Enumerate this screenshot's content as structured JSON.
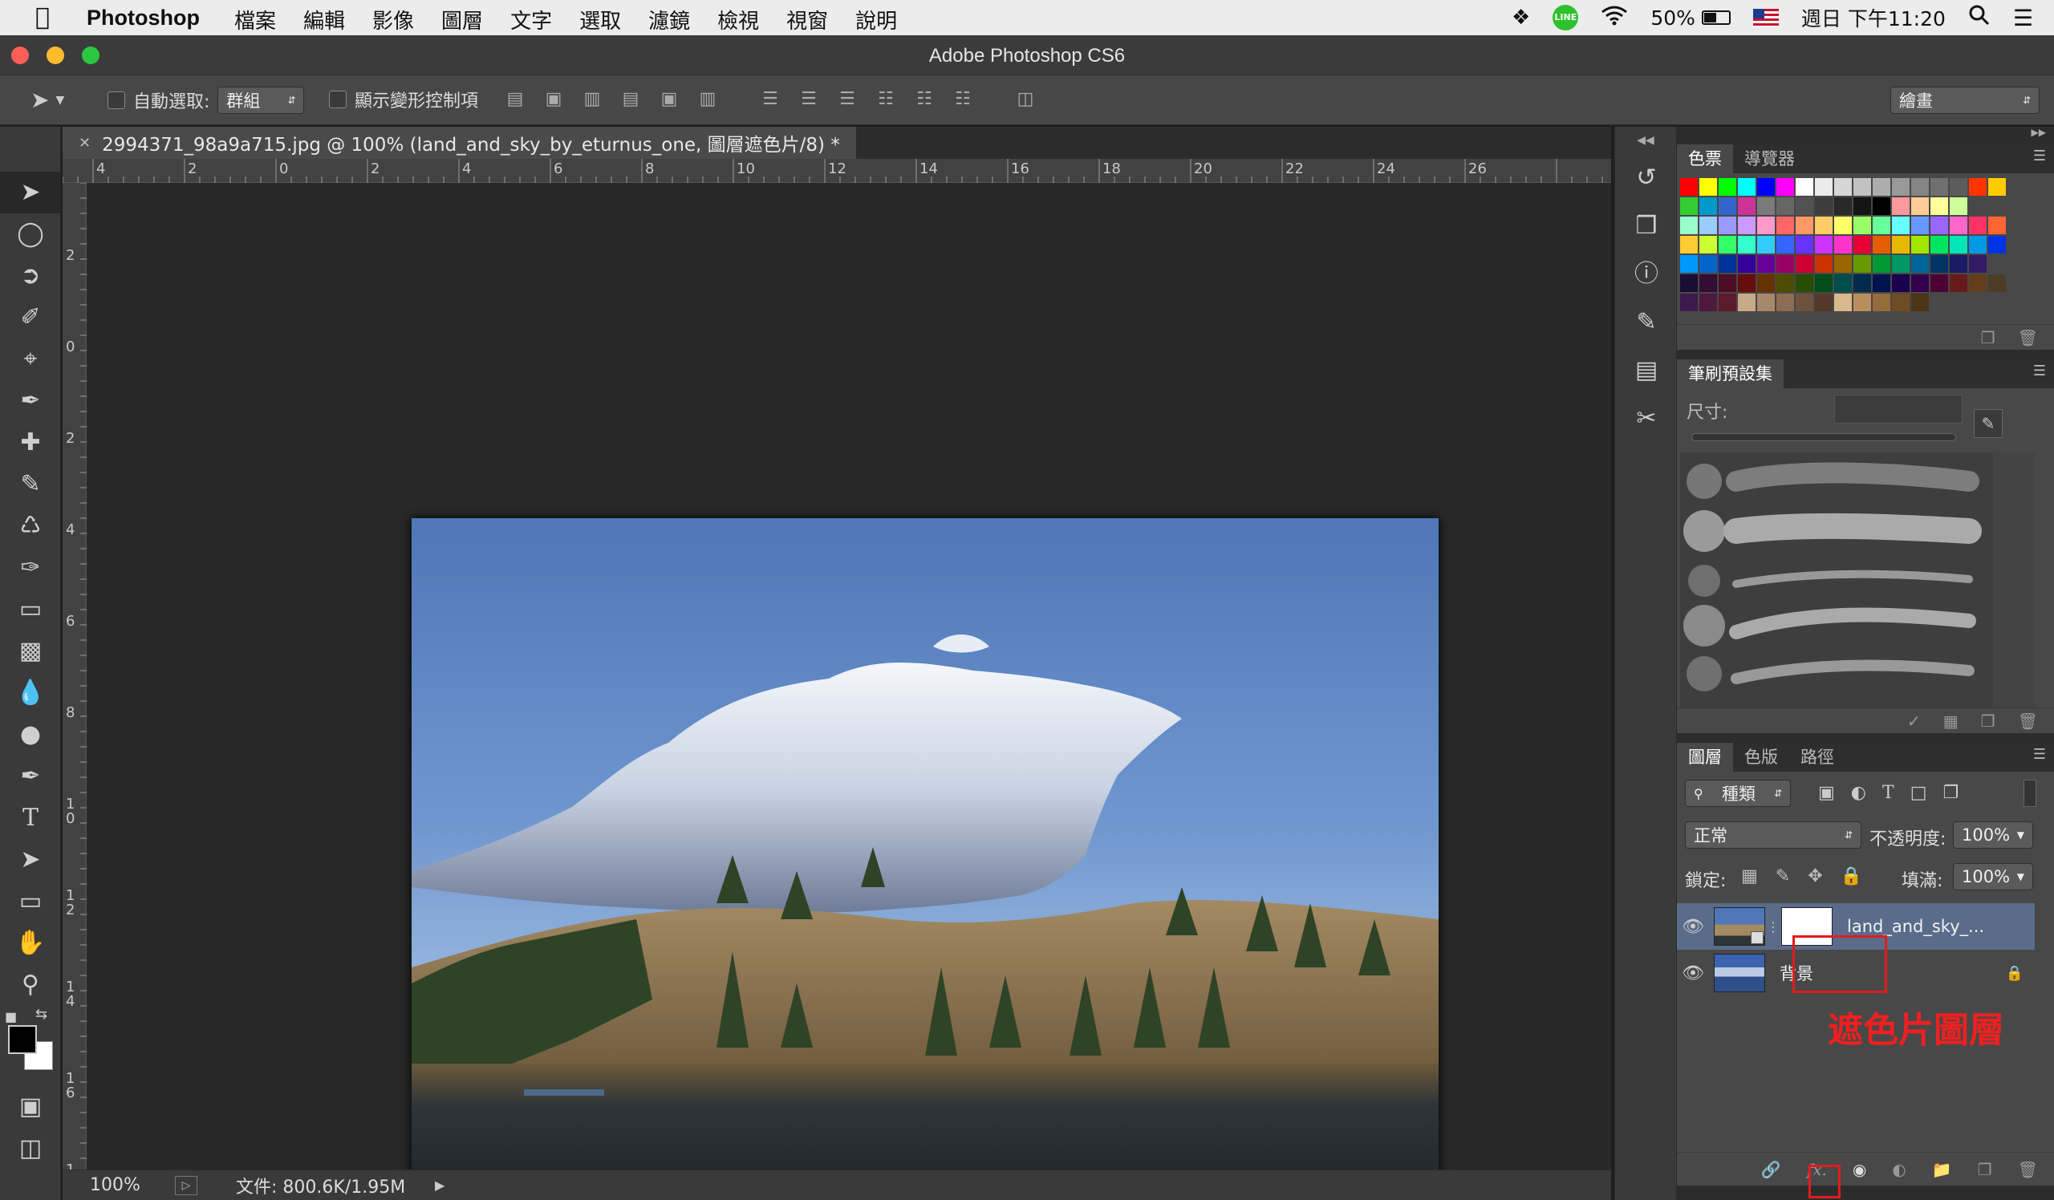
{
  "menubar": {
    "app_name": "Photoshop",
    "menus": [
      "檔案",
      "編輯",
      "影像",
      "圖層",
      "文字",
      "選取",
      "濾鏡",
      "檢視",
      "視窗",
      "說明"
    ],
    "battery": "50%",
    "clock": "週日 下午11:20"
  },
  "window": {
    "title": "Adobe Photoshop CS6"
  },
  "options": {
    "auto_select_label": "自動選取:",
    "auto_select_value": "群組",
    "show_transform_label": "顯示變形控制項",
    "workspace": "繪畫"
  },
  "document": {
    "tab_title": "2994371_98a9a715.jpg @ 100% (land_and_sky_by_eturnus_one, 圖層遮色片/8) *",
    "zoom": "100%",
    "file_info": "文件: 800.6K/1.95M"
  },
  "ruler": {
    "h_labels": [
      "4",
      "2",
      "0",
      "2",
      "4",
      "6",
      "8",
      "10",
      "12",
      "14",
      "16",
      "18",
      "20",
      "22",
      "24",
      "26"
    ],
    "v_labels": [
      "2",
      "0",
      "2",
      "4",
      "6",
      "8",
      "10",
      "12",
      "14",
      "16",
      "1"
    ]
  },
  "swatches_panel": {
    "tabs": [
      "色票",
      "導覽器"
    ],
    "rows": [
      [
        "#ff0000",
        "#ffff00",
        "#00ff00",
        "#00ffff",
        "#0000ff",
        "#ff00ff",
        "#ffffff",
        "#ebebeb",
        "#d6d6d6",
        "#c2c2c2",
        "#adadad",
        "#999999",
        "#858585",
        "#707070",
        "#5c5c5c",
        "#ff3300",
        "#ffcc00"
      ],
      [
        "#33cc33",
        "#0099cc",
        "#3366cc",
        "#cc3399",
        "#7a7a7a",
        "#666666",
        "#525252",
        "#3d3d3d",
        "#292929",
        "#141414",
        "#000000",
        "#ff9999",
        "#ffcc99",
        "#ffff99",
        "#ccff99"
      ],
      [
        "#99ffcc",
        "#99ccff",
        "#9999ff",
        "#cc99ff",
        "#ff99cc",
        "#ff6666",
        "#ff9966",
        "#ffcc66",
        "#ffff66",
        "#99ff66",
        "#66ff99",
        "#66ffff",
        "#6699ff",
        "#9966ff",
        "#ff66cc",
        "#ff3366",
        "#ff6633"
      ],
      [
        "#ffcc33",
        "#ccff33",
        "#33ff66",
        "#33ffcc",
        "#33ccff",
        "#3366ff",
        "#6633ff",
        "#cc33ff",
        "#ff33cc",
        "#e60033",
        "#e65c00",
        "#e6b800",
        "#a3e600",
        "#00e65c",
        "#00e6b8",
        "#0099e6",
        "#0033e6"
      ],
      [
        "#0099ff",
        "#0066cc",
        "#003399",
        "#330099",
        "#660099",
        "#990066",
        "#cc0033",
        "#cc3300",
        "#996600",
        "#669900",
        "#009933",
        "#009966",
        "#006699",
        "#003366",
        "#1a1a66",
        "#331a66"
      ],
      [
        "#1a0d33",
        "#330d33",
        "#4d0d26",
        "#660d0d",
        "#663300",
        "#4d4d00",
        "#264d00",
        "#004d1a",
        "#004d4d",
        "#002b4d",
        "#00134d",
        "#1a004d",
        "#33004d",
        "#4d0033",
        "#661a1a",
        "#663d1a",
        "#4d3d26"
      ],
      [
        "#3d1a4d",
        "#4d1a3d",
        "#5c1a2e",
        "#c8a98a",
        "#a8886a",
        "#8c6c52",
        "#6e523c",
        "#53392a",
        "#d8b98e",
        "#b88f5c",
        "#946c3a",
        "#6e4c24",
        "#4e3416"
      ]
    ]
  },
  "brush_panel": {
    "tab": "筆刷預設集",
    "size_label": "尺寸:"
  },
  "layers_panel": {
    "tabs": [
      "圖層",
      "色版",
      "路徑"
    ],
    "filter_kind": "種類",
    "blend_mode": "正常",
    "opacity_label": "不透明度:",
    "opacity_value": "100%",
    "lock_label": "鎖定:",
    "fill_label": "填滿:",
    "fill_value": "100%",
    "layers": [
      {
        "name": "land_and_sky_..."
      },
      {
        "name": "背景"
      }
    ],
    "annotation": "遮色片圖層"
  }
}
